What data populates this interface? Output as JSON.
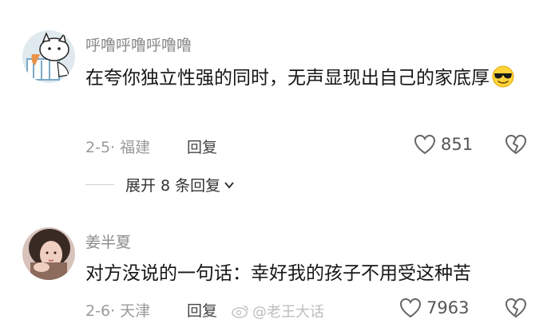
{
  "comments": [
    {
      "username": "呼噜呼噜呼噜噜",
      "text": "在夸你独立性强的同时，无声显现出自己的家底厚",
      "emoji": "sunglasses-emoji",
      "date_location": "2-5· 福建",
      "reply_label": "回复",
      "likes": "851",
      "expand_label": "展开 8 条回复"
    },
    {
      "username": "姜半夏",
      "text": "对方没说的一句话：幸好我的孩子不用受这种苦",
      "date_location": "2-6· 天津",
      "reply_label": "回复",
      "likes": "7963"
    }
  ],
  "watermark": "@老王大话",
  "icons": [
    "heart-outline-icon",
    "broken-heart-icon",
    "chevron-down-icon",
    "weibo-logo-icon"
  ]
}
